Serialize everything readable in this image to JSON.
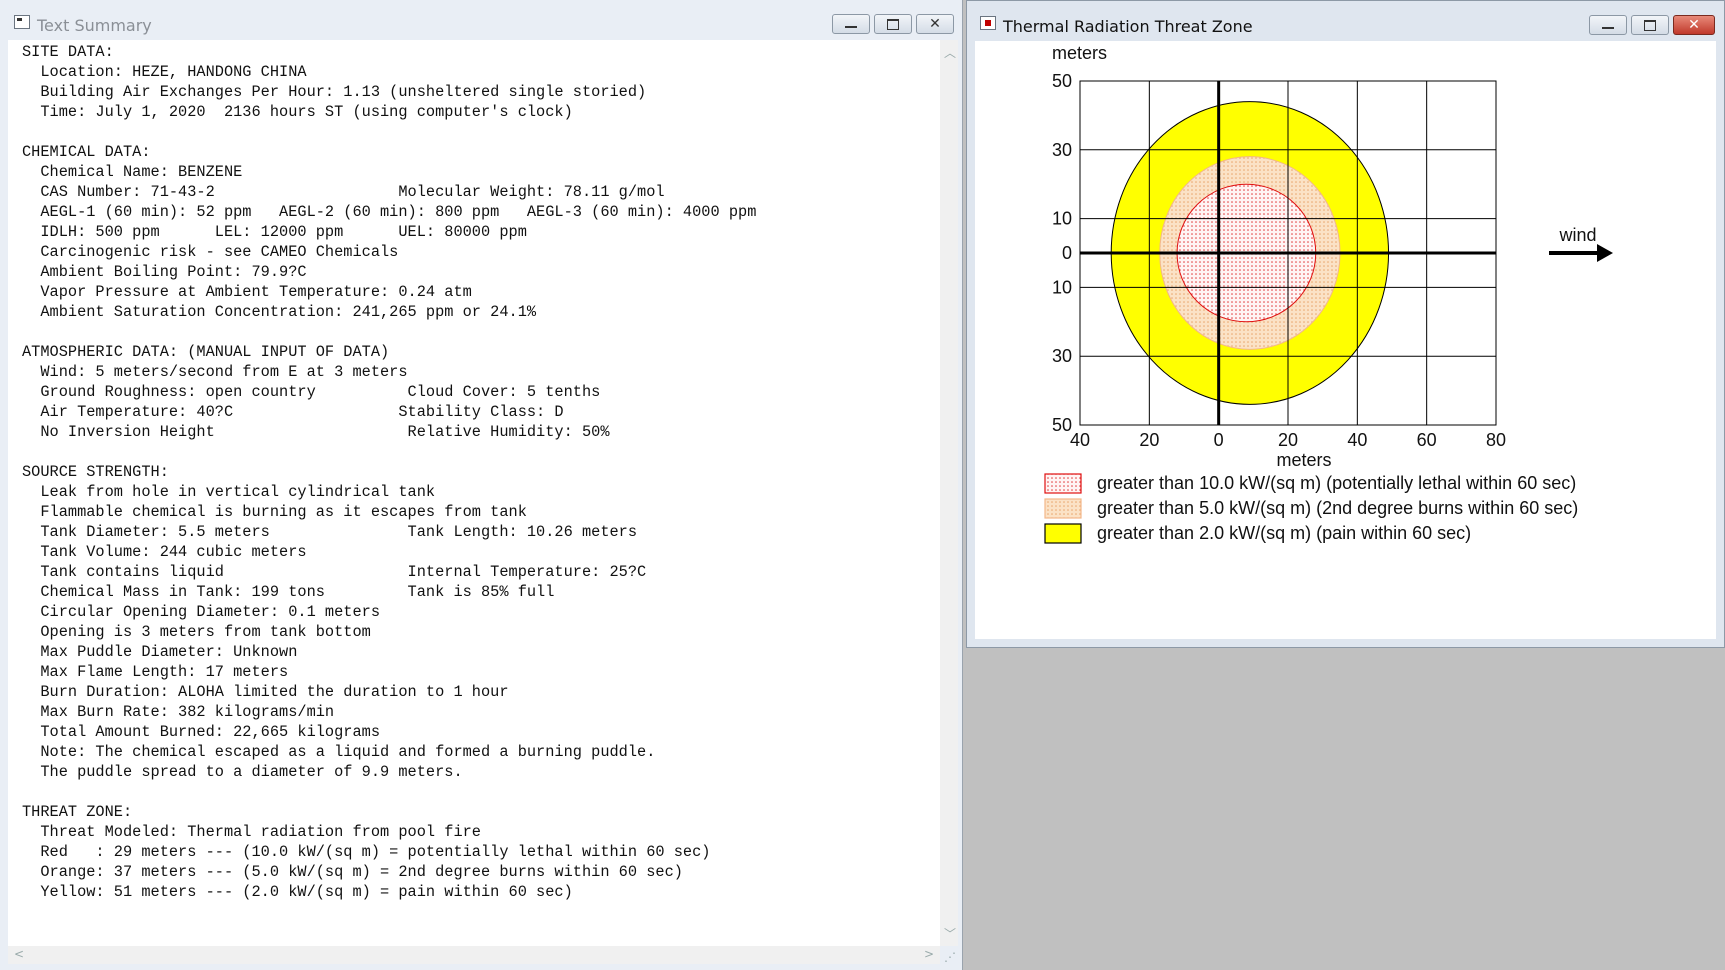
{
  "text_window": {
    "title": "Text Summary",
    "icon": "document-window-icon",
    "lines": [
      "SITE DATA:",
      "  Location: HEZE, HANDONG CHINA",
      "  Building Air Exchanges Per Hour: 1.13 (unsheltered single storied)",
      "  Time: July 1, 2020  2136 hours ST (using computer's clock)",
      "",
      "CHEMICAL DATA:",
      "  Chemical Name: BENZENE",
      "  CAS Number: 71-43-2                    Molecular Weight: 78.11 g/mol",
      "  AEGL-1 (60 min): 52 ppm   AEGL-2 (60 min): 800 ppm   AEGL-3 (60 min): 4000 ppm",
      "  IDLH: 500 ppm      LEL: 12000 ppm      UEL: 80000 ppm",
      "  Carcinogenic risk - see CAMEO Chemicals",
      "  Ambient Boiling Point: 79.9?C",
      "  Vapor Pressure at Ambient Temperature: 0.24 atm",
      "  Ambient Saturation Concentration: 241,265 ppm or 24.1%",
      "",
      "ATMOSPHERIC DATA: (MANUAL INPUT OF DATA)",
      "  Wind: 5 meters/second from E at 3 meters",
      "  Ground Roughness: open country          Cloud Cover: 5 tenths",
      "  Air Temperature: 40?C                  Stability Class: D",
      "  No Inversion Height                     Relative Humidity: 50%",
      "",
      "SOURCE STRENGTH:",
      "  Leak from hole in vertical cylindrical tank",
      "  Flammable chemical is burning as it escapes from tank",
      "  Tank Diameter: 5.5 meters               Tank Length: 10.26 meters",
      "  Tank Volume: 244 cubic meters",
      "  Tank contains liquid                    Internal Temperature: 25?C",
      "  Chemical Mass in Tank: 199 tons         Tank is 85% full",
      "  Circular Opening Diameter: 0.1 meters",
      "  Opening is 3 meters from tank bottom",
      "  Max Puddle Diameter: Unknown",
      "  Max Flame Length: 17 meters",
      "  Burn Duration: ALOHA limited the duration to 1 hour",
      "  Max Burn Rate: 382 kilograms/min",
      "  Total Amount Burned: 22,665 kilograms",
      "  Note: The chemical escaped as a liquid and formed a burning puddle.",
      "  The puddle spread to a diameter of 9.9 meters.",
      "",
      "THREAT ZONE:",
      "  Threat Modeled: Thermal radiation from pool fire",
      "  Red   : 29 meters --- (10.0 kW/(sq m) = potentially lethal within 60 sec)",
      "  Orange: 37 meters --- (5.0 kW/(sq m) = 2nd degree burns within 60 sec)",
      "  Yellow: 51 meters --- (2.0 kW/(sq m) = pain within 60 sec)"
    ]
  },
  "chart_window": {
    "title": "Thermal Radiation Threat Zone",
    "icon": "threat-zone-window-icon"
  },
  "chart_data": {
    "type": "threat-zone-map",
    "y_unit_label": "meters",
    "x_unit_label": "meters",
    "xlim": [
      -40,
      80
    ],
    "ylim": [
      -50,
      50
    ],
    "x_ticks": [
      {
        "value": -40,
        "label": "40"
      },
      {
        "value": -20,
        "label": "20"
      },
      {
        "value": 0,
        "label": "0"
      },
      {
        "value": 20,
        "label": "20"
      },
      {
        "value": 40,
        "label": "40"
      },
      {
        "value": 60,
        "label": "60"
      },
      {
        "value": 80,
        "label": "80"
      }
    ],
    "y_ticks": [
      {
        "value": 50,
        "label": "50"
      },
      {
        "value": 30,
        "label": "30"
      },
      {
        "value": 10,
        "label": "10"
      },
      {
        "value": 0,
        "label": "0"
      },
      {
        "value": -10,
        "label": "10"
      },
      {
        "value": -30,
        "label": "30"
      },
      {
        "value": -50,
        "label": "50"
      }
    ],
    "grid": true,
    "wind_label": "wind",
    "zones": [
      {
        "name": "yellow",
        "cx": 9,
        "cy": 0,
        "rx": 40,
        "ry": 44,
        "fill": "#ffff00",
        "stroke": "#000000",
        "pattern": "solid"
      },
      {
        "name": "orange",
        "cx": 9,
        "cy": 0,
        "rx": 26,
        "ry": 28,
        "fill": "#f9d6b0",
        "stroke": "#f3b78a",
        "pattern": "dots"
      },
      {
        "name": "red",
        "cx": 8,
        "cy": 0,
        "rx": 20,
        "ry": 20,
        "fill": "#fff2f2",
        "stroke": "#e01010",
        "pattern": "dots"
      }
    ],
    "legend": [
      {
        "label": "greater than 10.0 kW/(sq m) (potentially lethal within 60 sec)",
        "zone": "red"
      },
      {
        "label": "greater than 5.0 kW/(sq m) (2nd degree burns within 60 sec)",
        "zone": "orange"
      },
      {
        "label": "greater than 2.0 kW/(sq m) (pain within 60 sec)",
        "zone": "yellow"
      }
    ]
  }
}
